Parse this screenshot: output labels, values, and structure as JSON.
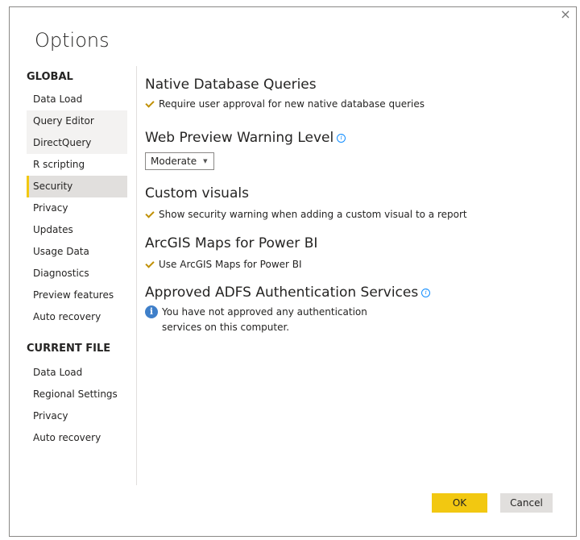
{
  "dialog": {
    "title": "Options",
    "close_glyph": "×"
  },
  "sidebar": {
    "global_heading": "GLOBAL",
    "global_items": [
      {
        "label": "Data Load"
      },
      {
        "label": "Query Editor"
      },
      {
        "label": "DirectQuery"
      },
      {
        "label": "R scripting"
      },
      {
        "label": "Security"
      },
      {
        "label": "Privacy"
      },
      {
        "label": "Updates"
      },
      {
        "label": "Usage Data"
      },
      {
        "label": "Diagnostics"
      },
      {
        "label": "Preview features"
      },
      {
        "label": "Auto recovery"
      }
    ],
    "current_heading": "CURRENT FILE",
    "current_items": [
      {
        "label": "Data Load"
      },
      {
        "label": "Regional Settings"
      },
      {
        "label": "Privacy"
      },
      {
        "label": "Auto recovery"
      }
    ],
    "active_item": "Security"
  },
  "main": {
    "native_db": {
      "title": "Native Database Queries",
      "checkbox_label": "Require user approval for new native database queries",
      "checked": true
    },
    "web_preview": {
      "title": "Web Preview Warning Level",
      "selected": "Moderate"
    },
    "custom_visuals": {
      "title": "Custom visuals",
      "checkbox_label": "Show security warning when adding a custom visual to a report",
      "checked": true
    },
    "arcgis": {
      "title": "ArcGIS Maps for Power BI",
      "checkbox_label": "Use ArcGIS Maps for Power BI",
      "checked": true
    },
    "adfs": {
      "title": "Approved ADFS Authentication Services",
      "message_line1": "You have not approved any authentication",
      "message_line2": "services on this computer."
    }
  },
  "footer": {
    "ok_label": "OK",
    "cancel_label": "Cancel"
  },
  "colors": {
    "accent": "#f2c811",
    "info_blue": "#118dff",
    "active_bg": "#e1dfdd"
  },
  "icons": {
    "close": "close-icon",
    "info": "info-icon",
    "check": "checkmark-icon",
    "chevron": "chevron-down-icon",
    "info_bubble": "info-circle-icon"
  }
}
